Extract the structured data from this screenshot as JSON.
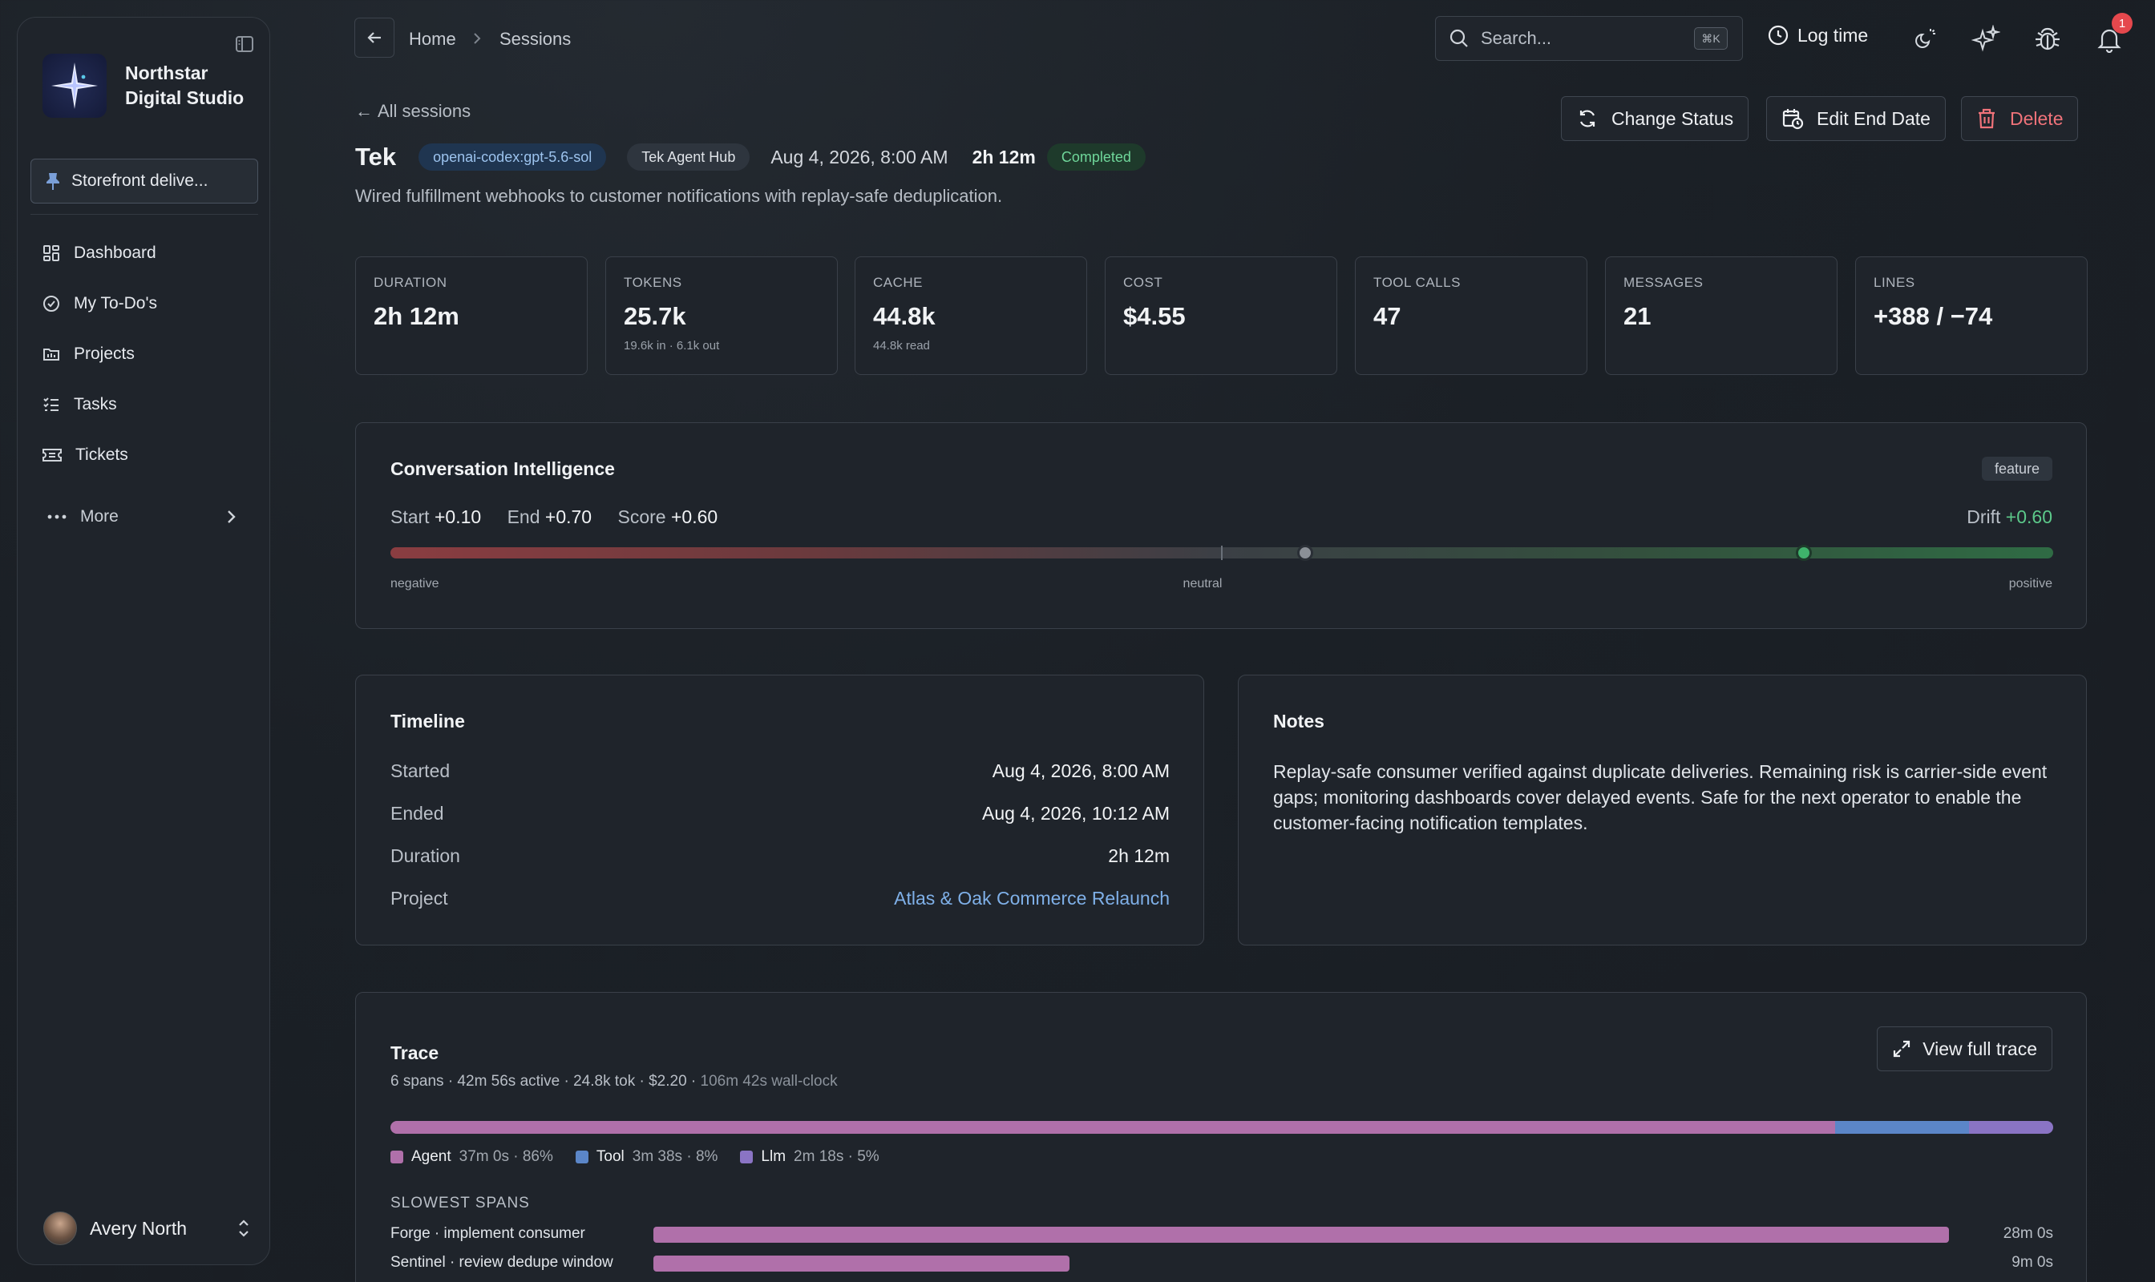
{
  "sidebar": {
    "brand": {
      "line1": "Northstar",
      "line2": "Digital Studio"
    },
    "workspace": "Storefront delive...",
    "items": [
      {
        "label": "Dashboard",
        "icon": "dashboard-icon"
      },
      {
        "label": "My To-Do's",
        "icon": "check-circle-icon"
      },
      {
        "label": "Projects",
        "icon": "folder-icon"
      },
      {
        "label": "Tasks",
        "icon": "list-icon"
      },
      {
        "label": "Tickets",
        "icon": "ticket-icon"
      }
    ],
    "more_label": "More",
    "user_name": "Avery North"
  },
  "topbar": {
    "breadcrumb": [
      "Home",
      "Sessions"
    ],
    "search_placeholder": "Search...",
    "search_shortcut": "⌘K",
    "log_time": "Log time",
    "notification_count": "1"
  },
  "session": {
    "back_link": "All sessions",
    "title": "Tek",
    "model_chip": "openai-codex:gpt-5.6-sol",
    "agent_chip": "Tek Agent Hub",
    "date": "Aug 4, 2026, 8:00 AM",
    "duration": "2h 12m",
    "status": "Completed",
    "summary": "Wired fulfillment webhooks to customer notifications with replay-safe deduplication."
  },
  "actions": {
    "change_status": "Change Status",
    "edit_end_date": "Edit End Date",
    "delete": "Delete"
  },
  "stats": [
    {
      "label": "DURATION",
      "value": "2h 12m",
      "sub": ""
    },
    {
      "label": "TOKENS",
      "value": "25.7k",
      "sub": "19.6k in · 6.1k out"
    },
    {
      "label": "CACHE",
      "value": "44.8k",
      "sub": "44.8k read"
    },
    {
      "label": "COST",
      "value": "$4.55",
      "sub": ""
    },
    {
      "label": "TOOL CALLS",
      "value": "47",
      "sub": ""
    },
    {
      "label": "MESSAGES",
      "value": "21",
      "sub": ""
    },
    {
      "label": "LINES",
      "value": "+388 / −74",
      "sub": ""
    }
  ],
  "conversation": {
    "title": "Conversation Intelligence",
    "tag": "feature",
    "start_label": "Start",
    "start_value": "+0.10",
    "end_label": "End",
    "end_value": "+0.70",
    "score_label": "Score",
    "score_value": "+0.60",
    "drift_label": "Drift",
    "drift_value": "+0.60",
    "scale": {
      "negative": "negative",
      "neutral": "neutral",
      "positive": "positive"
    },
    "start_marker": 0.1,
    "end_marker": 0.7
  },
  "timeline": {
    "title": "Timeline",
    "rows": [
      {
        "key": "Started",
        "value": "Aug 4, 2026, 8:00 AM"
      },
      {
        "key": "Ended",
        "value": "Aug 4, 2026, 10:12 AM"
      },
      {
        "key": "Duration",
        "value": "2h 12m"
      },
      {
        "key": "Project",
        "value": "Atlas & Oak Commerce Relaunch"
      }
    ]
  },
  "notes": {
    "title": "Notes",
    "text": "Replay-safe consumer verified against duplicate deliveries. Remaining risk is carrier-side event gaps; monitoring dashboards cover delayed events. Safe for the next operator to enable the customer-facing notification templates."
  },
  "trace": {
    "title": "Trace",
    "summary": "6 spans · 42m 56s active · 24.8k tok · $2.20 · ",
    "wall_clock": "106m 42s wall-clock",
    "view_full": "View full trace",
    "legend": [
      {
        "name": "Agent",
        "detail": "37m 0s · 86%",
        "pct": 86,
        "color": "#b070aa"
      },
      {
        "name": "Tool",
        "detail": "3m 38s · 8%",
        "pct": 8,
        "color": "#5b86c8"
      },
      {
        "name": "Llm",
        "detail": "2m 18s · 5%",
        "pct": 5,
        "color": "#8a74c4"
      }
    ],
    "slowest_label": "SLOWEST SPANS",
    "spans": [
      {
        "name": "Forge · implement consumer",
        "time": "28m 0s",
        "minutes": 28
      },
      {
        "name": "Sentinel · review dedupe window",
        "time": "9m 0s",
        "minutes": 9
      }
    ]
  }
}
